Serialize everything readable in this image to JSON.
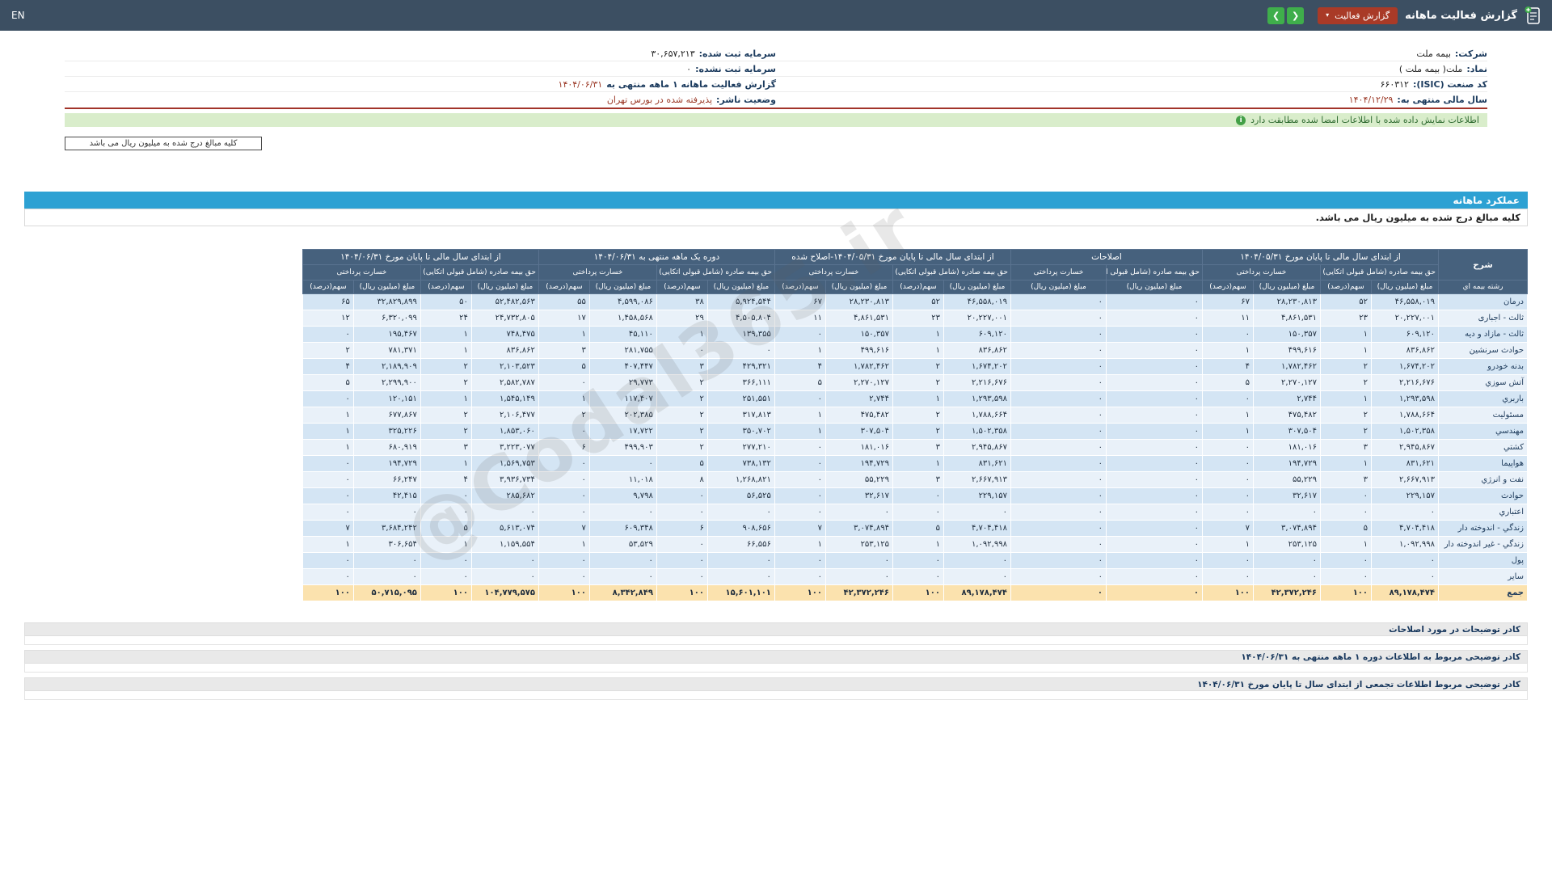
{
  "navbar": {
    "title": "گزارش فعالیت ماهانه",
    "report_button": "گزارش فعالیت",
    "caret": "▾",
    "prev_icon": "❮",
    "next_icon": "❯",
    "lang": "EN"
  },
  "info": {
    "right": [
      {
        "label": "شرکت:",
        "value": "بیمه ملت"
      },
      {
        "label": "نماد:",
        "value": "ملت( بیمه ملت )"
      },
      {
        "label": "کد صنعت (ISIC):",
        "value": "۶۶۰۳۱۲"
      },
      {
        "label": "سال مالی منتهی به:",
        "value": "۱۴۰۴/۱۲/۲۹"
      }
    ],
    "left": [
      {
        "label": "سرمایه ثبت شده:",
        "value": "۳۰,۶۵۷,۲۱۳"
      },
      {
        "label": "سرمایه ثبت نشده:",
        "value": "۰"
      },
      {
        "label": "گزارش فعالیت ماهانه ۱ ماهه منتهی به",
        "value": "۱۴۰۴/۰۶/۳۱"
      },
      {
        "label": "وضعیت ناشر:",
        "value": "پذیرفته شده در بورس تهران"
      }
    ]
  },
  "notice": {
    "text": "اطلاعات نمایش داده شده با اطلاعات امضا شده مطابقت دارد",
    "icon_glyph": "i"
  },
  "unit_box": "کلیه مبالغ درج شده به میلیون ریال می باشد",
  "section": {
    "title": "عملکرد ماهانه",
    "note": "کلیه مبالغ درج شده به میلیون ریال می باشد."
  },
  "watermark": "@Codal365.ir",
  "table": {
    "col_label": "شرح",
    "row_header": "رشته بیمه اي",
    "group_labels": [
      "از ابتدای سال مالی تا پایان مورخ ۱۴۰۴/۰۵/۳۱",
      "اصلاحات",
      "از ابتدای سال مالی تا پایان مورخ ۱۴۰۴/۰۵/۳۱-اصلاح شده",
      "دوره یک ماهه منتهی به ۱۴۰۴/۰۶/۳۱",
      "از ابتدای سال مالی تا پایان مورخ ۱۴۰۴/۰۶/۳۱"
    ],
    "premium_label": "حق بیمه صادره (شامل قبولی اتکایی)",
    "claims_label": "خسارت پرداختی",
    "amount_label": "مبلغ (میلیون ریال)",
    "share_label": "سهم(درصد)",
    "rows": [
      {
        "name": "درمان",
        "cells": [
          "۴۶,۵۵۸,۰۱۹",
          "۵۲",
          "۲۸,۲۳۰,۸۱۳",
          "۶۷",
          "۰",
          "۰",
          "۴۶,۵۵۸,۰۱۹",
          "۵۲",
          "۲۸,۲۳۰,۸۱۳",
          "۶۷",
          "۵,۹۲۴,۵۴۴",
          "۳۸",
          "۴,۵۹۹,۰۸۶",
          "۵۵",
          "۵۲,۴۸۲,۵۶۳",
          "۵۰",
          "۳۲,۸۲۹,۸۹۹",
          "۶۵"
        ]
      },
      {
        "name": "ثالث - اجباری",
        "cells": [
          "۲۰,۲۲۷,۰۰۱",
          "۲۳",
          "۴,۸۶۱,۵۳۱",
          "۱۱",
          "۰",
          "۰",
          "۲۰,۲۲۷,۰۰۱",
          "۲۳",
          "۴,۸۶۱,۵۳۱",
          "۱۱",
          "۴,۵۰۵,۸۰۴",
          "۲۹",
          "۱,۴۵۸,۵۶۸",
          "۱۷",
          "۲۴,۷۳۲,۸۰۵",
          "۲۴",
          "۶,۳۲۰,۰۹۹",
          "۱۲"
        ]
      },
      {
        "name": "ثالث - مازاد و دیه",
        "cells": [
          "۶۰۹,۱۲۰",
          "۱",
          "۱۵۰,۳۵۷",
          "۰",
          "۰",
          "۰",
          "۶۰۹,۱۲۰",
          "۱",
          "۱۵۰,۳۵۷",
          "۰",
          "۱۳۹,۳۵۵",
          "۱",
          "۴۵,۱۱۰",
          "۱",
          "۷۴۸,۴۷۵",
          "۱",
          "۱۹۵,۴۶۷",
          "۰"
        ]
      },
      {
        "name": "حوادث سرنشین",
        "cells": [
          "۸۳۶,۸۶۲",
          "۱",
          "۴۹۹,۶۱۶",
          "۱",
          "۰",
          "۰",
          "۸۳۶,۸۶۲",
          "۱",
          "۴۹۹,۶۱۶",
          "۱",
          "۰",
          "۰",
          "۲۸۱,۷۵۵",
          "۳",
          "۸۳۶,۸۶۲",
          "۱",
          "۷۸۱,۳۷۱",
          "۲"
        ]
      },
      {
        "name": "بدنه خودرو",
        "cells": [
          "۱,۶۷۴,۲۰۲",
          "۲",
          "۱,۷۸۲,۴۶۲",
          "۴",
          "۰",
          "۰",
          "۱,۶۷۴,۲۰۲",
          "۲",
          "۱,۷۸۲,۴۶۲",
          "۴",
          "۴۲۹,۳۲۱",
          "۳",
          "۴۰۷,۴۴۷",
          "۵",
          "۲,۱۰۳,۵۲۳",
          "۲",
          "۲,۱۸۹,۹۰۹",
          "۴"
        ]
      },
      {
        "name": "آتش سوزي",
        "cells": [
          "۲,۲۱۶,۶۷۶",
          "۲",
          "۲,۲۷۰,۱۲۷",
          "۵",
          "۰",
          "۰",
          "۲,۲۱۶,۶۷۶",
          "۲",
          "۲,۲۷۰,۱۲۷",
          "۵",
          "۳۶۶,۱۱۱",
          "۲",
          "۲۹,۷۷۳",
          "۰",
          "۲,۵۸۲,۷۸۷",
          "۲",
          "۲,۲۹۹,۹۰۰",
          "۵"
        ]
      },
      {
        "name": "باربري",
        "cells": [
          "۱,۲۹۳,۵۹۸",
          "۱",
          "۲,۷۴۴",
          "۰",
          "۰",
          "۰",
          "۱,۲۹۳,۵۹۸",
          "۱",
          "۲,۷۴۴",
          "۰",
          "۲۵۱,۵۵۱",
          "۲",
          "۱۱۷,۴۰۷",
          "۱",
          "۱,۵۴۵,۱۴۹",
          "۱",
          "۱۲۰,۱۵۱",
          "۰"
        ]
      },
      {
        "name": "مسئولیت",
        "cells": [
          "۱,۷۸۸,۶۶۴",
          "۲",
          "۴۷۵,۴۸۲",
          "۱",
          "۰",
          "۰",
          "۱,۷۸۸,۶۶۴",
          "۲",
          "۴۷۵,۴۸۲",
          "۱",
          "۳۱۷,۸۱۳",
          "۲",
          "۲۰۲,۳۸۵",
          "۲",
          "۲,۱۰۶,۴۷۷",
          "۲",
          "۶۷۷,۸۶۷",
          "۱"
        ]
      },
      {
        "name": "مهندسي",
        "cells": [
          "۱,۵۰۲,۳۵۸",
          "۲",
          "۳۰۷,۵۰۴",
          "۱",
          "۰",
          "۰",
          "۱,۵۰۲,۳۵۸",
          "۲",
          "۳۰۷,۵۰۴",
          "۱",
          "۳۵۰,۷۰۲",
          "۲",
          "۱۷,۷۲۲",
          "۰",
          "۱,۸۵۳,۰۶۰",
          "۲",
          "۳۲۵,۲۲۶",
          "۱"
        ]
      },
      {
        "name": "کشتي",
        "cells": [
          "۲,۹۴۵,۸۶۷",
          "۳",
          "۱۸۱,۰۱۶",
          "۰",
          "۰",
          "۰",
          "۲,۹۴۵,۸۶۷",
          "۳",
          "۱۸۱,۰۱۶",
          "۰",
          "۲۷۷,۲۱۰",
          "۲",
          "۴۹۹,۹۰۳",
          "۶",
          "۳,۲۲۳,۰۷۷",
          "۳",
          "۶۸۰,۹۱۹",
          "۱"
        ]
      },
      {
        "name": "هواپیما",
        "cells": [
          "۸۳۱,۶۲۱",
          "۱",
          "۱۹۴,۷۲۹",
          "۰",
          "۰",
          "۰",
          "۸۳۱,۶۲۱",
          "۱",
          "۱۹۴,۷۲۹",
          "۰",
          "۷۳۸,۱۳۲",
          "۵",
          "۰",
          "۰",
          "۱,۵۶۹,۷۵۳",
          "۱",
          "۱۹۴,۷۲۹",
          "۰"
        ]
      },
      {
        "name": "نفت و انرژي",
        "cells": [
          "۲,۶۶۷,۹۱۳",
          "۳",
          "۵۵,۲۲۹",
          "۰",
          "۰",
          "۰",
          "۲,۶۶۷,۹۱۳",
          "۳",
          "۵۵,۲۲۹",
          "۰",
          "۱,۲۶۸,۸۲۱",
          "۸",
          "۱۱,۰۱۸",
          "۰",
          "۳,۹۳۶,۷۳۴",
          "۴",
          "۶۶,۲۴۷",
          "۰"
        ]
      },
      {
        "name": "حوادث",
        "cells": [
          "۲۲۹,۱۵۷",
          "۰",
          "۳۲,۶۱۷",
          "۰",
          "۰",
          "۰",
          "۲۲۹,۱۵۷",
          "۰",
          "۳۲,۶۱۷",
          "۰",
          "۵۶,۵۲۵",
          "۰",
          "۹,۷۹۸",
          "۰",
          "۲۸۵,۶۸۲",
          "۰",
          "۴۲,۴۱۵",
          "۰"
        ]
      },
      {
        "name": "اعتباري",
        "cells": [
          "۰",
          "۰",
          "۰",
          "۰",
          "۰",
          "۰",
          "۰",
          "۰",
          "۰",
          "۰",
          "۰",
          "۰",
          "۰",
          "۰",
          "۰",
          "۰",
          "۰",
          "۰"
        ]
      },
      {
        "name": "زندگي - اندوخته دار",
        "cells": [
          "۴,۷۰۴,۴۱۸",
          "۵",
          "۳,۰۷۴,۸۹۴",
          "۷",
          "۰",
          "۰",
          "۴,۷۰۴,۴۱۸",
          "۵",
          "۳,۰۷۴,۸۹۴",
          "۷",
          "۹۰۸,۶۵۶",
          "۶",
          "۶۰۹,۳۴۸",
          "۷",
          "۵,۶۱۳,۰۷۴",
          "۵",
          "۳,۶۸۴,۲۴۲",
          "۷"
        ]
      },
      {
        "name": "زندگي - غیر اندوخته دار",
        "cells": [
          "۱,۰۹۲,۹۹۸",
          "۱",
          "۲۵۳,۱۲۵",
          "۱",
          "۰",
          "۰",
          "۱,۰۹۲,۹۹۸",
          "۱",
          "۲۵۳,۱۲۵",
          "۱",
          "۶۶,۵۵۶",
          "۰",
          "۵۳,۵۲۹",
          "۱",
          "۱,۱۵۹,۵۵۴",
          "۱",
          "۳۰۶,۶۵۴",
          "۱"
        ]
      },
      {
        "name": "پول",
        "cells": [
          "۰",
          "۰",
          "۰",
          "۰",
          "۰",
          "۰",
          "۰",
          "۰",
          "۰",
          "۰",
          "۰",
          "۰",
          "۰",
          "۰",
          "۰",
          "۰",
          "۰",
          "۰"
        ]
      },
      {
        "name": "سایر",
        "cells": [
          "۰",
          "۰",
          "۰",
          "۰",
          "۰",
          "۰",
          "۰",
          "۰",
          "۰",
          "۰",
          "۰",
          "۰",
          "۰",
          "۰",
          "۰",
          "۰",
          "۰",
          "۰"
        ]
      },
      {
        "name": "جمع",
        "total": true,
        "cells": [
          "۸۹,۱۷۸,۴۷۴",
          "۱۰۰",
          "۴۲,۳۷۲,۲۴۶",
          "۱۰۰",
          "۰",
          "۰",
          "۸۹,۱۷۸,۴۷۴",
          "۱۰۰",
          "۴۲,۳۷۲,۲۴۶",
          "۱۰۰",
          "۱۵,۶۰۱,۱۰۱",
          "۱۰۰",
          "۸,۳۴۲,۸۴۹",
          "۱۰۰",
          "۱۰۴,۷۷۹,۵۷۵",
          "۱۰۰",
          "۵۰,۷۱۵,۰۹۵",
          "۱۰۰"
        ]
      }
    ]
  },
  "footer": {
    "boxes": [
      {
        "title": "کادر توضیحات در مورد اصلاحات"
      },
      {
        "title": "کادر توضیحی مربوط به اطلاعات دوره ۱ ماهه منتهی به ۱۴۰۴/۰۶/۳۱"
      },
      {
        "title": "کادر توضیحی مربوط اطلاعات تجمعی از ابتدای سال تا پایان مورخ ۱۴۰۴/۰۶/۳۱"
      }
    ]
  }
}
